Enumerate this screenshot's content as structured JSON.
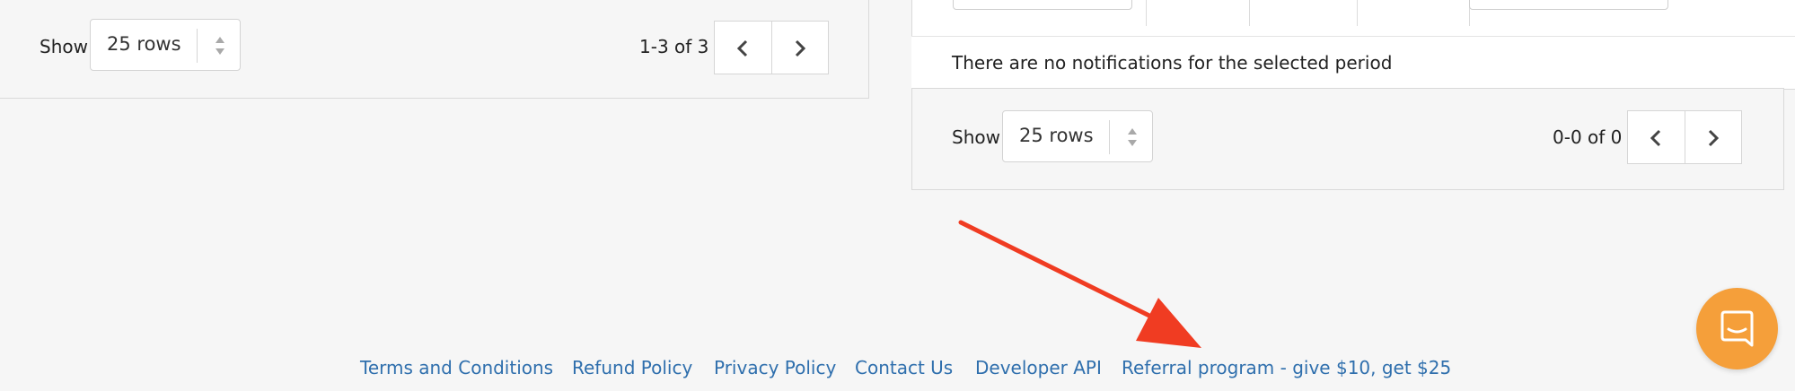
{
  "left_panel": {
    "show_label": "Show",
    "rows_select_value": "25 rows",
    "pagination_count": "1-3 of 3"
  },
  "right_panel": {
    "empty_message": "There are no notifications for the selected period",
    "show_label": "Show",
    "rows_select_value": "25 rows",
    "pagination_count": "0-0 of 0"
  },
  "footer": {
    "links": [
      "Terms and Conditions",
      "Refund Policy",
      "Privacy Policy",
      "Contact Us",
      "Developer API",
      "Referral program - give $10, get $25"
    ]
  },
  "chat": {
    "icon": "chat-bubble-icon",
    "color": "#f59f3a"
  },
  "annotation": {
    "icon": "red-arrow-icon",
    "color": "#f03c22"
  },
  "colors": {
    "link": "#2f6fad",
    "background": "#f6f6f6"
  }
}
